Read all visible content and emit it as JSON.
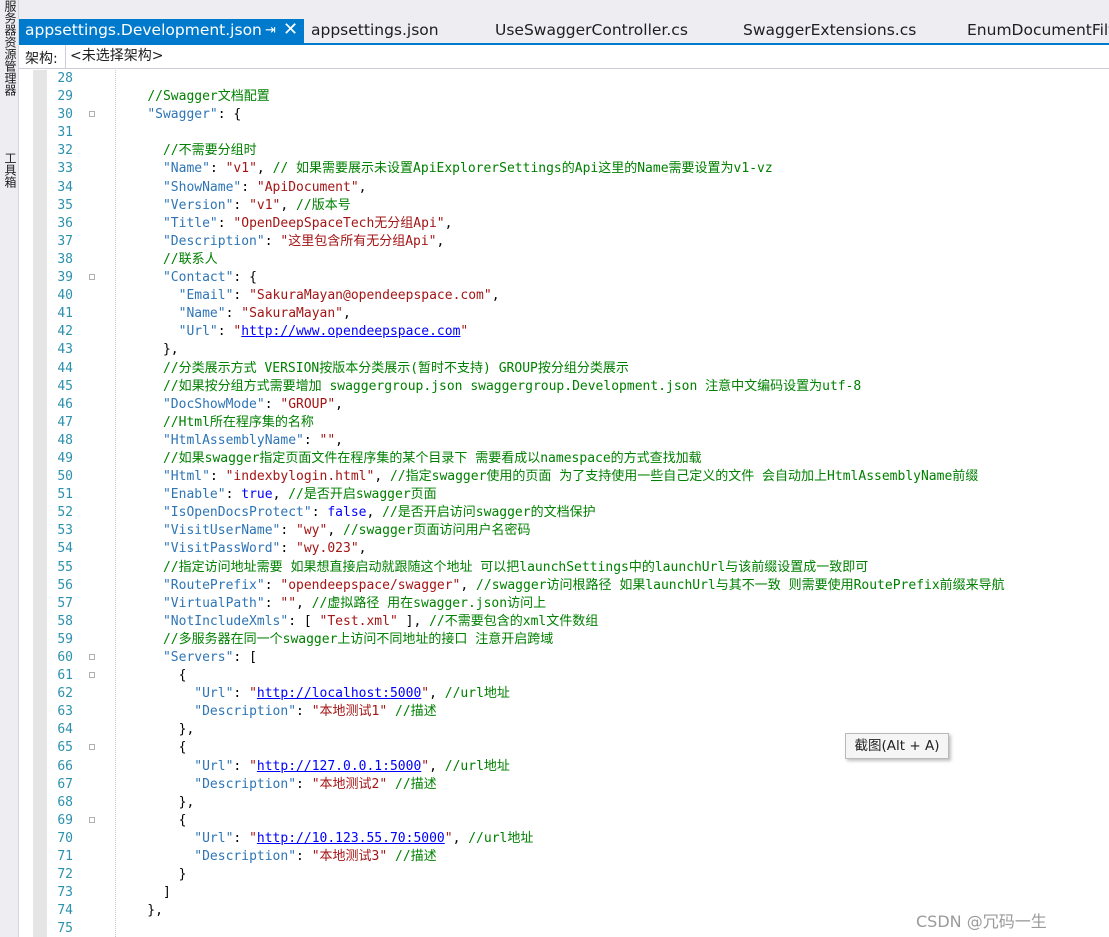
{
  "sidebar": {
    "tab1": "服务器资源管理器",
    "tab2": "工具箱"
  },
  "tabs": [
    {
      "label": "appsettings.Development.json",
      "active": true
    },
    {
      "label": "appsettings.json"
    },
    {
      "label": "UseSwaggerController.cs"
    },
    {
      "label": "SwaggerExtensions.cs"
    },
    {
      "label": "EnumDocumentFilte"
    }
  ],
  "toolbar": {
    "pin_icon": "pin-icon",
    "close_icon": "close-icon"
  },
  "arch_bar": {
    "label": "架构:",
    "value": "<未选择架构>"
  },
  "colors": {
    "accent": "#007acc",
    "key": "#2e75b6",
    "string": "#a31515",
    "comment": "#008000",
    "keyword": "#0000ff",
    "line_number": "#2b91af"
  },
  "lines": [
    {
      "n": "28",
      "fold": false,
      "seg": []
    },
    {
      "n": "29",
      "fold": false,
      "seg": [
        [
          "    ",
          "p"
        ],
        [
          "//Swagger文档配置",
          "c"
        ]
      ]
    },
    {
      "n": "30",
      "fold": true,
      "seg": [
        [
          "    ",
          "p"
        ],
        [
          "\"Swagger\"",
          "k"
        ],
        [
          ": {",
          "p"
        ]
      ]
    },
    {
      "n": "31",
      "fold": false,
      "seg": []
    },
    {
      "n": "32",
      "fold": false,
      "seg": [
        [
          "      ",
          "p"
        ],
        [
          "//不需要分组时",
          "c"
        ]
      ]
    },
    {
      "n": "33",
      "fold": false,
      "seg": [
        [
          "      ",
          "p"
        ],
        [
          "\"Name\"",
          "k"
        ],
        [
          ": ",
          "p"
        ],
        [
          "\"v1\"",
          "s"
        ],
        [
          ", ",
          "p"
        ],
        [
          "// 如果需要展示未设置ApiExplorerSettings的Api这里的Name需要设置为v1-vz",
          "c"
        ]
      ]
    },
    {
      "n": "34",
      "fold": false,
      "seg": [
        [
          "      ",
          "p"
        ],
        [
          "\"ShowName\"",
          "k"
        ],
        [
          ": ",
          "p"
        ],
        [
          "\"ApiDocument\"",
          "s"
        ],
        [
          ",",
          "p"
        ]
      ]
    },
    {
      "n": "35",
      "fold": false,
      "seg": [
        [
          "      ",
          "p"
        ],
        [
          "\"Version\"",
          "k"
        ],
        [
          ": ",
          "p"
        ],
        [
          "\"v1\"",
          "s"
        ],
        [
          ", ",
          "p"
        ],
        [
          "//版本号",
          "c"
        ]
      ]
    },
    {
      "n": "36",
      "fold": false,
      "seg": [
        [
          "      ",
          "p"
        ],
        [
          "\"Title\"",
          "k"
        ],
        [
          ": ",
          "p"
        ],
        [
          "\"OpenDeepSpaceTech无分组Api\"",
          "s"
        ],
        [
          ",",
          "p"
        ]
      ]
    },
    {
      "n": "37",
      "fold": false,
      "seg": [
        [
          "      ",
          "p"
        ],
        [
          "\"Description\"",
          "k"
        ],
        [
          ": ",
          "p"
        ],
        [
          "\"这里包含所有无分组Api\"",
          "s"
        ],
        [
          ",",
          "p"
        ]
      ]
    },
    {
      "n": "38",
      "fold": false,
      "seg": [
        [
          "      ",
          "p"
        ],
        [
          "//联系人",
          "c"
        ]
      ]
    },
    {
      "n": "39",
      "fold": true,
      "seg": [
        [
          "      ",
          "p"
        ],
        [
          "\"Contact\"",
          "k"
        ],
        [
          ": {",
          "p"
        ]
      ]
    },
    {
      "n": "40",
      "fold": false,
      "seg": [
        [
          "        ",
          "p"
        ],
        [
          "\"Email\"",
          "k"
        ],
        [
          ": ",
          "p"
        ],
        [
          "\"SakuraMayan@opendeepspace.com\"",
          "s"
        ],
        [
          ",",
          "p"
        ]
      ]
    },
    {
      "n": "41",
      "fold": false,
      "seg": [
        [
          "        ",
          "p"
        ],
        [
          "\"Name\"",
          "k"
        ],
        [
          ": ",
          "p"
        ],
        [
          "\"SakuraMayan\"",
          "s"
        ],
        [
          ",",
          "p"
        ]
      ]
    },
    {
      "n": "42",
      "fold": false,
      "seg": [
        [
          "        ",
          "p"
        ],
        [
          "\"Url\"",
          "k"
        ],
        [
          ": ",
          "p"
        ],
        [
          "\"",
          "s"
        ],
        [
          "http://www.opendeepspace.com",
          "u"
        ],
        [
          "\"",
          "s"
        ]
      ]
    },
    {
      "n": "43",
      "fold": false,
      "seg": [
        [
          "      ",
          "p"
        ],
        [
          "},",
          "p"
        ]
      ]
    },
    {
      "n": "44",
      "fold": false,
      "seg": [
        [
          "      ",
          "p"
        ],
        [
          "//分类展示方式 VERSION按版本分类展示(暂时不支持) GROUP按分组分类展示",
          "c"
        ]
      ]
    },
    {
      "n": "45",
      "fold": false,
      "seg": [
        [
          "      ",
          "p"
        ],
        [
          "//如果按分组方式需要增加 swaggergroup.json swaggergroup.Development.json 注意中文编码设置为utf-8",
          "c"
        ]
      ]
    },
    {
      "n": "46",
      "fold": false,
      "seg": [
        [
          "      ",
          "p"
        ],
        [
          "\"DocShowMode\"",
          "k"
        ],
        [
          ": ",
          "p"
        ],
        [
          "\"GROUP\"",
          "s"
        ],
        [
          ",",
          "p"
        ]
      ]
    },
    {
      "n": "47",
      "fold": false,
      "seg": [
        [
          "      ",
          "p"
        ],
        [
          "//Html所在程序集的名称",
          "c"
        ]
      ]
    },
    {
      "n": "48",
      "fold": false,
      "seg": [
        [
          "      ",
          "p"
        ],
        [
          "\"HtmlAssemblyName\"",
          "k"
        ],
        [
          ": ",
          "p"
        ],
        [
          "\"\"",
          "s"
        ],
        [
          ",",
          "p"
        ]
      ]
    },
    {
      "n": "49",
      "fold": false,
      "seg": [
        [
          "      ",
          "p"
        ],
        [
          "//如果swagger指定页面文件在程序集的某个目录下 需要看成以namespace的方式查找加载",
          "c"
        ]
      ]
    },
    {
      "n": "50",
      "fold": false,
      "seg": [
        [
          "      ",
          "p"
        ],
        [
          "\"Html\"",
          "k"
        ],
        [
          ": ",
          "p"
        ],
        [
          "\"indexbylogin.html\"",
          "s"
        ],
        [
          ", ",
          "p"
        ],
        [
          "//指定swagger使用的页面 为了支持使用一些自己定义的文件 会自动加上HtmlAssemblyName前缀",
          "c"
        ]
      ]
    },
    {
      "n": "51",
      "fold": false,
      "seg": [
        [
          "      ",
          "p"
        ],
        [
          "\"Enable\"",
          "k"
        ],
        [
          ": ",
          "p"
        ],
        [
          "true",
          "b"
        ],
        [
          ", ",
          "p"
        ],
        [
          "//是否开启swagger页面",
          "c"
        ]
      ]
    },
    {
      "n": "52",
      "fold": false,
      "seg": [
        [
          "      ",
          "p"
        ],
        [
          "\"IsOpenDocsProtect\"",
          "k"
        ],
        [
          ": ",
          "p"
        ],
        [
          "false",
          "b"
        ],
        [
          ", ",
          "p"
        ],
        [
          "//是否开启访问swagger的文档保护",
          "c"
        ]
      ]
    },
    {
      "n": "53",
      "fold": false,
      "seg": [
        [
          "      ",
          "p"
        ],
        [
          "\"VisitUserName\"",
          "k"
        ],
        [
          ": ",
          "p"
        ],
        [
          "\"wy\"",
          "s"
        ],
        [
          ", ",
          "p"
        ],
        [
          "//swagger页面访问用户名密码",
          "c"
        ]
      ]
    },
    {
      "n": "54",
      "fold": false,
      "seg": [
        [
          "      ",
          "p"
        ],
        [
          "\"VisitPassWord\"",
          "k"
        ],
        [
          ": ",
          "p"
        ],
        [
          "\"wy.023\"",
          "s"
        ],
        [
          ",",
          "p"
        ]
      ]
    },
    {
      "n": "55",
      "fold": false,
      "seg": [
        [
          "      ",
          "p"
        ],
        [
          "//指定访问地址需要 如果想直接启动就跟随这个地址 可以把launchSettings中的launchUrl与该前缀设置成一致即可",
          "c"
        ]
      ]
    },
    {
      "n": "56",
      "fold": false,
      "seg": [
        [
          "      ",
          "p"
        ],
        [
          "\"RoutePrefix\"",
          "k"
        ],
        [
          ": ",
          "p"
        ],
        [
          "\"opendeepspace/swagger\"",
          "s"
        ],
        [
          ", ",
          "p"
        ],
        [
          "//swagger访问根路径 如果launchUrl与其不一致 则需要使用RoutePrefix前缀来导航",
          "c"
        ]
      ]
    },
    {
      "n": "57",
      "fold": false,
      "seg": [
        [
          "      ",
          "p"
        ],
        [
          "\"VirtualPath\"",
          "k"
        ],
        [
          ": ",
          "p"
        ],
        [
          "\"\"",
          "s"
        ],
        [
          ", ",
          "p"
        ],
        [
          "//虚拟路径 用在swagger.json访问上",
          "c"
        ]
      ]
    },
    {
      "n": "58",
      "fold": false,
      "seg": [
        [
          "      ",
          "p"
        ],
        [
          "\"NotIncludeXmls\"",
          "k"
        ],
        [
          ": [ ",
          "p"
        ],
        [
          "\"Test.xml\"",
          "s"
        ],
        [
          " ], ",
          "p"
        ],
        [
          "//不需要包含的xml文件数组",
          "c"
        ]
      ]
    },
    {
      "n": "59",
      "fold": false,
      "seg": [
        [
          "      ",
          "p"
        ],
        [
          "//多服务器在同一个swagger上访问不同地址的接口 注意开启跨域",
          "c"
        ]
      ]
    },
    {
      "n": "60",
      "fold": true,
      "seg": [
        [
          "      ",
          "p"
        ],
        [
          "\"Servers\"",
          "k"
        ],
        [
          ": [",
          "p"
        ]
      ]
    },
    {
      "n": "61",
      "fold": true,
      "seg": [
        [
          "        {",
          "p"
        ]
      ]
    },
    {
      "n": "62",
      "fold": false,
      "seg": [
        [
          "          ",
          "p"
        ],
        [
          "\"Url\"",
          "k"
        ],
        [
          ": ",
          "p"
        ],
        [
          "\"",
          "s"
        ],
        [
          "http://localhost:5000",
          "u"
        ],
        [
          "\"",
          "s"
        ],
        [
          ", ",
          "p"
        ],
        [
          "//url地址",
          "c"
        ]
      ]
    },
    {
      "n": "63",
      "fold": false,
      "seg": [
        [
          "          ",
          "p"
        ],
        [
          "\"Description\"",
          "k"
        ],
        [
          ": ",
          "p"
        ],
        [
          "\"本地测试1\"",
          "s"
        ],
        [
          " ",
          "p"
        ],
        [
          "//描述",
          "c"
        ]
      ]
    },
    {
      "n": "64",
      "fold": false,
      "seg": [
        [
          "        },",
          "p"
        ]
      ]
    },
    {
      "n": "65",
      "fold": true,
      "seg": [
        [
          "        {",
          "p"
        ]
      ]
    },
    {
      "n": "66",
      "fold": false,
      "seg": [
        [
          "          ",
          "p"
        ],
        [
          "\"Url\"",
          "k"
        ],
        [
          ": ",
          "p"
        ],
        [
          "\"",
          "s"
        ],
        [
          "http://127.0.0.1:5000",
          "u"
        ],
        [
          "\"",
          "s"
        ],
        [
          ", ",
          "p"
        ],
        [
          "//url地址",
          "c"
        ]
      ]
    },
    {
      "n": "67",
      "fold": false,
      "seg": [
        [
          "          ",
          "p"
        ],
        [
          "\"Description\"",
          "k"
        ],
        [
          ": ",
          "p"
        ],
        [
          "\"本地测试2\"",
          "s"
        ],
        [
          " ",
          "p"
        ],
        [
          "//描述",
          "c"
        ]
      ]
    },
    {
      "n": "68",
      "fold": false,
      "seg": [
        [
          "        },",
          "p"
        ]
      ]
    },
    {
      "n": "69",
      "fold": true,
      "seg": [
        [
          "        {",
          "p"
        ]
      ]
    },
    {
      "n": "70",
      "fold": false,
      "seg": [
        [
          "          ",
          "p"
        ],
        [
          "\"Url\"",
          "k"
        ],
        [
          ": ",
          "p"
        ],
        [
          "\"",
          "s"
        ],
        [
          "http://10.123.55.70:5000",
          "u"
        ],
        [
          "\"",
          "s"
        ],
        [
          ", ",
          "p"
        ],
        [
          "//url地址",
          "c"
        ]
      ]
    },
    {
      "n": "71",
      "fold": false,
      "seg": [
        [
          "          ",
          "p"
        ],
        [
          "\"Description\"",
          "k"
        ],
        [
          ": ",
          "p"
        ],
        [
          "\"本地测试3\"",
          "s"
        ],
        [
          " ",
          "p"
        ],
        [
          "//描述",
          "c"
        ]
      ]
    },
    {
      "n": "72",
      "fold": false,
      "seg": [
        [
          "        }",
          "p"
        ]
      ]
    },
    {
      "n": "73",
      "fold": false,
      "seg": [
        [
          "      ]",
          "p"
        ]
      ]
    },
    {
      "n": "74",
      "fold": false,
      "seg": [
        [
          "    },",
          "p"
        ]
      ]
    },
    {
      "n": "75",
      "fold": false,
      "seg": []
    }
  ],
  "tooltip": "截图(Alt + A)",
  "watermark": "CSDN @冗码一生"
}
